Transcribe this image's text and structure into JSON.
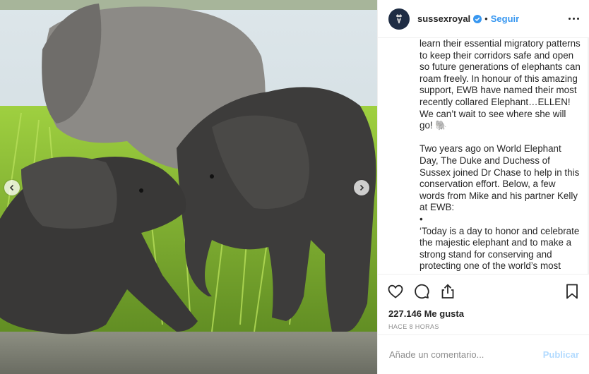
{
  "account": {
    "username": "sussexroyal",
    "separator": "•",
    "follow_label": "Seguir",
    "verified_icon": "verified-badge-icon",
    "brand_color": "#1f2d44",
    "accent_color": "#3897f0"
  },
  "caption": {
    "text": "learn their essential migratory patterns to keep their corridors safe and open so future generations of elephants can roam freely. In honour of this amazing support, EWB have named their most recently collared Elephant…ELLEN! We can’t wait to see where she will go! 🐘\n\nTwo years ago on World Elephant Day, The Duke and Duchess of Sussex joined Dr Chase to help in this conservation effort. Below, a few words from Mike and his partner Kelly at EWB:\n•\n‘Today is a day to honor and celebrate the majestic elephant and to make a strong stand for conserving and protecting one of the world’s most beloved animals. elephants are"
  },
  "actions": {
    "icons": [
      "heart-icon",
      "comment-icon",
      "share-icon",
      "bookmark-icon"
    ]
  },
  "stats": {
    "likes": "227.146 Me gusta",
    "time": "HACE 8 HORAS"
  },
  "comment_box": {
    "placeholder": "Añade un comentario...",
    "publish_label": "Publicar"
  },
  "media": {
    "description_icons": [
      "chevron-left-icon",
      "chevron-right-icon"
    ]
  }
}
